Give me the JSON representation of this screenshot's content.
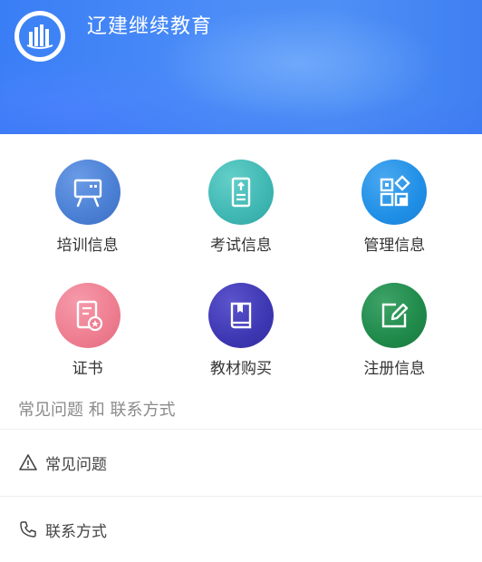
{
  "header": {
    "app_title": "辽建继续教育",
    "logo_icon": "building-logo-icon"
  },
  "grid": [
    {
      "label": "培训信息",
      "icon": "presentation-board-icon",
      "color": "#4a7fd4"
    },
    {
      "label": "考试信息",
      "icon": "exam-paper-icon",
      "color": "#3fb7b3"
    },
    {
      "label": "管理信息",
      "icon": "apps-grid-icon",
      "color": "#1f8fe6"
    },
    {
      "label": "证书",
      "icon": "certificate-icon",
      "color": "#ee7d90"
    },
    {
      "label": "教材购买",
      "icon": "book-icon",
      "color": "#3e37b3"
    },
    {
      "label": "注册信息",
      "icon": "edit-form-icon",
      "color": "#1f8a4a"
    }
  ],
  "faq_section": {
    "title": "常见问题 和 联系方式",
    "items": [
      {
        "label": "常见问题",
        "icon": "warning-icon"
      },
      {
        "label": "联系方式",
        "icon": "phone-icon"
      }
    ]
  }
}
